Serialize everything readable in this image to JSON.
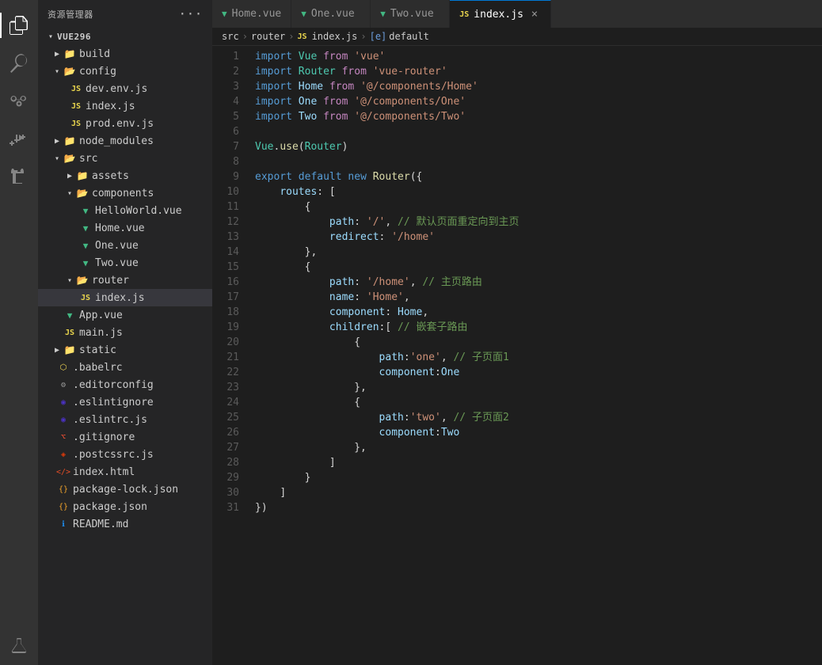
{
  "appTitle": "资源管理器",
  "activityIcons": [
    {
      "name": "files-icon",
      "symbol": "⧉",
      "active": true
    },
    {
      "name": "search-icon",
      "symbol": "🔍",
      "active": false
    },
    {
      "name": "source-control-icon",
      "symbol": "⎇",
      "active": false
    },
    {
      "name": "run-icon",
      "symbol": "▷",
      "active": false
    },
    {
      "name": "extensions-icon",
      "symbol": "⊞",
      "active": false
    },
    {
      "name": "test-icon",
      "symbol": "⚗",
      "active": false
    }
  ],
  "sidebar": {
    "title": "资源管理器",
    "dotsLabel": "···",
    "rootProject": "VUE296",
    "tree": [
      {
        "id": "build",
        "label": "build",
        "type": "folder",
        "indent": 1,
        "collapsed": true
      },
      {
        "id": "config",
        "label": "config",
        "type": "folder",
        "indent": 1,
        "collapsed": false
      },
      {
        "id": "dev.env.js",
        "label": "dev.env.js",
        "type": "js",
        "indent": 2
      },
      {
        "id": "index.js-config",
        "label": "index.js",
        "type": "js",
        "indent": 2
      },
      {
        "id": "prod.env.js",
        "label": "prod.env.js",
        "type": "js",
        "indent": 2
      },
      {
        "id": "node_modules",
        "label": "node_modules",
        "type": "folder",
        "indent": 1,
        "collapsed": true
      },
      {
        "id": "src",
        "label": "src",
        "type": "folder",
        "indent": 1,
        "collapsed": false
      },
      {
        "id": "assets",
        "label": "assets",
        "type": "folder",
        "indent": 2,
        "collapsed": true
      },
      {
        "id": "components",
        "label": "components",
        "type": "folder",
        "indent": 2,
        "collapsed": false
      },
      {
        "id": "HelloWorld.vue",
        "label": "HelloWorld.vue",
        "type": "vue",
        "indent": 3
      },
      {
        "id": "Home.vue",
        "label": "Home.vue",
        "type": "vue",
        "indent": 3
      },
      {
        "id": "One.vue",
        "label": "One.vue",
        "type": "vue",
        "indent": 3
      },
      {
        "id": "Two.vue",
        "label": "Two.vue",
        "type": "vue",
        "indent": 3
      },
      {
        "id": "router",
        "label": "router",
        "type": "folder",
        "indent": 2,
        "collapsed": false
      },
      {
        "id": "index.js-router",
        "label": "index.js",
        "type": "js",
        "indent": 3,
        "active": true
      },
      {
        "id": "App.vue",
        "label": "App.vue",
        "type": "vue",
        "indent": 2
      },
      {
        "id": "main.js",
        "label": "main.js",
        "type": "js",
        "indent": 2
      },
      {
        "id": "static",
        "label": "static",
        "type": "folder",
        "indent": 1,
        "collapsed": true
      },
      {
        "id": ".babelrc",
        "label": ".babelrc",
        "type": "babel",
        "indent": 1
      },
      {
        "id": ".editorconfig",
        "label": ".editorconfig",
        "type": "config",
        "indent": 1
      },
      {
        "id": ".eslintignore",
        "label": ".eslintignore",
        "type": "eslint",
        "indent": 1
      },
      {
        "id": ".eslintrc.js",
        "label": ".eslintrc.js",
        "type": "eslint-js",
        "indent": 1
      },
      {
        "id": ".gitignore",
        "label": ".gitignore",
        "type": "git",
        "indent": 1
      },
      {
        "id": ".postcssrc.js",
        "label": ".postcssrc.js",
        "type": "postcss",
        "indent": 1
      },
      {
        "id": "index.html",
        "label": "index.html",
        "type": "html",
        "indent": 1
      },
      {
        "id": "package-lock.json",
        "label": "package-lock.json",
        "type": "json",
        "indent": 1
      },
      {
        "id": "package.json",
        "label": "package.json",
        "type": "json",
        "indent": 1
      },
      {
        "id": "README.md",
        "label": "README.md",
        "type": "md",
        "indent": 1
      }
    ]
  },
  "tabs": [
    {
      "id": "home-vue",
      "label": "Home.vue",
      "type": "vue",
      "active": false,
      "closable": false
    },
    {
      "id": "one-vue",
      "label": "One.vue",
      "type": "vue",
      "active": false,
      "closable": false
    },
    {
      "id": "two-vue",
      "label": "Two.vue",
      "type": "vue",
      "active": false,
      "closable": false
    },
    {
      "id": "index-js",
      "label": "index.js",
      "type": "js",
      "active": true,
      "closable": true
    }
  ],
  "breadcrumb": {
    "parts": [
      "src",
      "router",
      "index.js",
      "default"
    ]
  },
  "code": {
    "lines": [
      {
        "num": 1,
        "html": "<span class='kw'>import</span> <span class='var'>Vue</span> <span class='kw2'>from</span> <span class='str'>'vue'</span>"
      },
      {
        "num": 2,
        "html": "<span class='kw'>import</span> <span class='var'>Router</span> <span class='kw2'>from</span> <span class='str'>'vue-router'</span>"
      },
      {
        "num": 3,
        "html": "<span class='kw'>import</span> <span class='var2'>Home</span> <span class='kw2'>from</span> <span class='str'>'@/components/Home'</span>"
      },
      {
        "num": 4,
        "html": "<span class='kw'>import</span> <span class='var2'>One</span> <span class='kw2'>from</span> <span class='str'>'@/components/One'</span>"
      },
      {
        "num": 5,
        "html": "<span class='kw'>import</span> <span class='var2'>Two</span> <span class='kw2'>from</span> <span class='str'>'@/components/Two'</span>"
      },
      {
        "num": 6,
        "html": ""
      },
      {
        "num": 7,
        "html": "<span class='var'>Vue</span><span class='punct'>.</span><span class='fn'>use</span><span class='punct'>(</span><span class='var'>Router</span><span class='punct'>)</span>"
      },
      {
        "num": 8,
        "html": ""
      },
      {
        "num": 9,
        "html": "<span class='kw'>export</span> <span class='kw'>default</span> <span class='kw'>new</span> <span class='fn'>Router</span><span class='punct'>({</span>"
      },
      {
        "num": 10,
        "html": "    <span class='prop'>routes</span><span class='punct'>: [</span>"
      },
      {
        "num": 11,
        "html": "        <span class='punct'>{</span>"
      },
      {
        "num": 12,
        "html": "            <span class='prop'>path</span><span class='punct'>: </span><span class='str'>'/'</span><span class='punct'>,</span> <span class='comment'>// 默认页面重定向到主页</span>"
      },
      {
        "num": 13,
        "html": "            <span class='prop'>redirect</span><span class='punct'>: </span><span class='str'>'/home'</span>"
      },
      {
        "num": 14,
        "html": "        <span class='punct'>},</span>"
      },
      {
        "num": 15,
        "html": "        <span class='punct'>{</span>"
      },
      {
        "num": 16,
        "html": "            <span class='prop'>path</span><span class='punct'>: </span><span class='str'>'/home'</span><span class='punct'>,</span> <span class='comment'>// 主页路由</span>"
      },
      {
        "num": 17,
        "html": "            <span class='prop'>name</span><span class='punct'>: </span><span class='str'>'Home'</span><span class='punct'>,</span>"
      },
      {
        "num": 18,
        "html": "            <span class='prop'>component</span><span class='punct'>: </span><span class='var2'>Home</span><span class='punct'>,</span>"
      },
      {
        "num": 19,
        "html": "            <span class='prop'>children</span><span class='punct'>:[</span> <span class='comment'>// 嵌套子路由</span>"
      },
      {
        "num": 20,
        "html": "                <span class='punct'>{</span>"
      },
      {
        "num": 21,
        "html": "                    <span class='prop'>path</span><span class='punct'>:</span><span class='str'>'one'</span><span class='punct'>,</span> <span class='comment'>// 子页面1</span>"
      },
      {
        "num": 22,
        "html": "                    <span class='prop'>component</span><span class='punct'>:</span><span class='var2'>One</span>"
      },
      {
        "num": 23,
        "html": "                <span class='punct'>},</span>"
      },
      {
        "num": 24,
        "html": "                <span class='punct'>{</span>"
      },
      {
        "num": 25,
        "html": "                    <span class='prop'>path</span><span class='punct'>:</span><span class='str'>'two'</span><span class='punct'>,</span> <span class='comment'>// 子页面2</span>"
      },
      {
        "num": 26,
        "html": "                    <span class='prop'>component</span><span class='punct'>:</span><span class='var2'>Two</span>"
      },
      {
        "num": 27,
        "html": "                <span class='punct'>},</span>"
      },
      {
        "num": 28,
        "html": "            <span class='punct'>]</span>"
      },
      {
        "num": 29,
        "html": "        <span class='punct'>}</span>"
      },
      {
        "num": 30,
        "html": "    <span class='punct'>]</span>"
      },
      {
        "num": 31,
        "html": "<span class='punct'>})</span>"
      }
    ]
  }
}
